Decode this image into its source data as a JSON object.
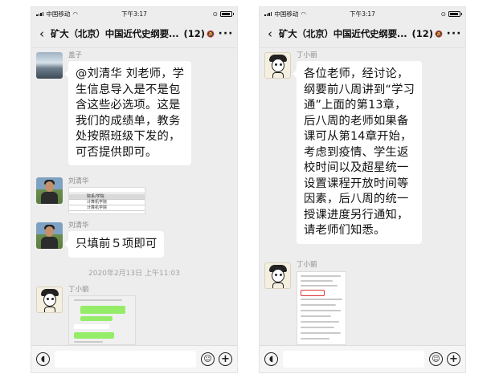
{
  "status_bar": {
    "carrier": "中国移动",
    "time": "下午3:17"
  },
  "chat": {
    "title": "矿大（北京）中国近代史纲要...",
    "member_count": "(12)"
  },
  "left": {
    "messages": [
      {
        "sender": "盖子",
        "lines": [
          "@刘清华 刘老师，学",
          "生信息导入是不是包",
          "含这些必选项。这是",
          "我们的成绩单，教务",
          "处按照班级下发的，",
          "可否提供即可。"
        ]
      },
      {
        "sender": "刘清华",
        "image_rows": [
          "院系/学院",
          "计算机学院",
          "计算机学院"
        ]
      },
      {
        "sender": "刘清华",
        "lines": [
          "只填前５项即可"
        ]
      }
    ],
    "timestamp": "2020年2月13日 上午11:03",
    "last_sender": "丁小丽"
  },
  "right": {
    "messages": [
      {
        "sender": "丁小丽",
        "lines": [
          "各位老师，经讨论，",
          "纲要前八周讲到“学习",
          "通”上面的第13章，",
          "后八周的老师如果备",
          "课可从第14章开始，",
          "考虑到疫情、学生返",
          "校时间以及超星统一",
          "设置课程开放时间等",
          "因素，后八周的统一",
          "授课进度另行通知，",
          "请老师们知悉。"
        ]
      }
    ],
    "last_sender": "丁小丽"
  },
  "icons": {
    "back": "chevron-left-icon",
    "more": "more-icon",
    "mute": "mute-icon",
    "voice": "voice-icon",
    "emoji": "emoji-icon",
    "plus": "plus-icon"
  },
  "colors": {
    "chat_background": "#ededed",
    "bubble": "#ffffff",
    "wechat_green": "#95ec69"
  }
}
